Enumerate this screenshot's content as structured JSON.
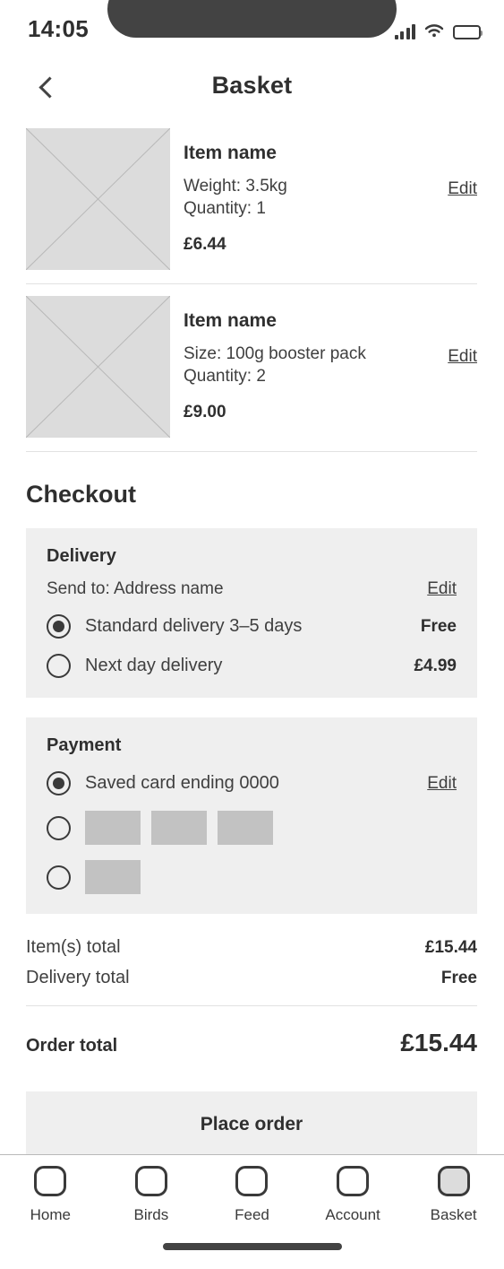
{
  "status_bar": {
    "time": "14:05",
    "signal_icon": "cellular-signal-icon",
    "wifi_icon": "wifi-icon",
    "battery_icon": "battery-full-icon"
  },
  "header": {
    "back_icon": "chevron-left-icon",
    "title": "Basket"
  },
  "basket": {
    "items": [
      {
        "name": "Item name",
        "attribute": "Weight: 3.5kg",
        "quantity": "Quantity: 1",
        "price": "£6.44",
        "edit_label": "Edit"
      },
      {
        "name": "Item name",
        "attribute": "Size: 100g booster pack",
        "quantity": "Quantity: 2",
        "price": "£9.00",
        "edit_label": "Edit"
      }
    ]
  },
  "checkout": {
    "title": "Checkout",
    "delivery": {
      "title": "Delivery",
      "send_to": "Send to: Address name",
      "edit_label": "Edit",
      "options": [
        {
          "label": "Standard delivery 3–5 days",
          "price": "Free",
          "selected": true
        },
        {
          "label": "Next day delivery",
          "price": "£4.99",
          "selected": false
        }
      ]
    },
    "payment": {
      "title": "Payment",
      "edit_label": "Edit",
      "options": [
        {
          "label": "Saved card ending 0000",
          "selected": true,
          "logos": 0
        },
        {
          "label": "",
          "selected": false,
          "logos": 3
        },
        {
          "label": "",
          "selected": false,
          "logos": 1
        }
      ]
    },
    "totals": [
      {
        "label": "Item(s) total",
        "value": "£15.44"
      },
      {
        "label": "Delivery total",
        "value": "Free"
      }
    ],
    "order_total": {
      "label": "Order total",
      "value": "£15.44"
    },
    "place_order_label": "Place order"
  },
  "tabbar": {
    "items": [
      {
        "label": "Home",
        "icon": "home-icon",
        "active": false
      },
      {
        "label": "Birds",
        "icon": "birds-icon",
        "active": false
      },
      {
        "label": "Feed",
        "icon": "feed-icon",
        "active": false
      },
      {
        "label": "Account",
        "icon": "account-icon",
        "active": false
      },
      {
        "label": "Basket",
        "icon": "basket-icon",
        "active": true
      }
    ]
  },
  "colors": {
    "text": "#3c3c3c",
    "panel_bg": "#efefef",
    "placeholder": "#dcdcdc",
    "logo_block": "#c2c2c2",
    "divider": "#e2e2e2"
  }
}
